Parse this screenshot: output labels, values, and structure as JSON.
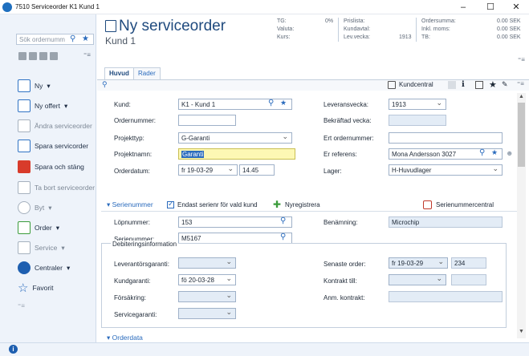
{
  "window": {
    "title": "7510 Serviceorder K1 Kund 1",
    "minimize": "–",
    "maximize": "☐",
    "close": "✕"
  },
  "sidebar": {
    "search_placeholder": "Sök ordernumm",
    "items": [
      {
        "label": "Ny",
        "icon": "new-document-icon"
      },
      {
        "label": "Ny offert",
        "icon": "offer-icon"
      },
      {
        "label": "Ändra serviceorder",
        "icon": "edit-icon"
      },
      {
        "label": "Spara servicorder",
        "icon": "save-icon"
      },
      {
        "label": "Spara och stäng",
        "icon": "save-close-icon"
      },
      {
        "label": "Ta bort serviceorder",
        "icon": "delete-icon"
      },
      {
        "label": "Byt",
        "icon": "swap-icon"
      },
      {
        "label": "Order",
        "icon": "order-icon"
      },
      {
        "label": "Service",
        "icon": "service-icon"
      },
      {
        "label": "Centraler",
        "icon": "central-icon"
      },
      {
        "label": "Favorit",
        "icon": "star-icon"
      }
    ]
  },
  "header": {
    "title": "Ny serviceorder",
    "subtitle": "Kund 1",
    "tg_label": "TG:",
    "tg_value": "0%",
    "valuta_label": "Valuta:",
    "kurs_label": "Kurs:",
    "prislista_label": "Prislista:",
    "kundavtal_label": "Kundavtal:",
    "levvecka_label": "Lev.vecka:",
    "levvecka_value": "1913",
    "ordersumma_label": "Ordersumma:",
    "ordersumma_value": "0.00 SEK",
    "inklmoms_label": "Inkl. moms:",
    "inklmoms_value": "0.00 SEK",
    "tb_label": "TB:",
    "tb_value": "0.00 SEK"
  },
  "tabs": [
    {
      "label": "Huvud",
      "active": true
    },
    {
      "label": "Rader",
      "active": false
    }
  ],
  "toolbar": {
    "kundcentral": "Kundcentral"
  },
  "form": {
    "kund_label": "Kund:",
    "kund_value": "K1 - Kund 1",
    "ordernummer_label": "Ordernummer:",
    "ordernummer_value": "",
    "projekttyp_label": "Projekttyp:",
    "projekttyp_value": "G-Garanti",
    "projektnamn_label": "Projektnamn:",
    "projektnamn_value": "Garanti",
    "orderdatum_label": "Orderdatum:",
    "orderdatum_value": "fr 19-03-29",
    "ordertid_value": "14.45",
    "leveransvecka_label": "Leveransvecka:",
    "leveransvecka_value": "1913",
    "bekraftad_label": "Bekräftad vecka:",
    "bekraftad_value": "",
    "ert_ordernummer_label": "Ert ordernummer:",
    "ert_ordernummer_value": "",
    "er_referens_label": "Er referens:",
    "er_referens_value": "Mona Andersson 3027",
    "lager_label": "Lager:",
    "lager_value": "H-Huvudlager"
  },
  "serial": {
    "section_title": "Serienummer",
    "only_for_customer": "Endast serienr för vald kund",
    "register": "Nyregistrera",
    "central": "Serienummercentral",
    "lopnummer_label": "Löpnummer:",
    "lopnummer_value": "153",
    "serienummer_label": "Serienummer:",
    "serienummer_value": "M5167",
    "benamning_label": "Benämning:",
    "benamning_value": "Microchip"
  },
  "debit": {
    "legend": "Debiteringsinformation",
    "leverantor_label": "Leverantörsgaranti:",
    "leverantor_value": "",
    "kundgaranti_label": "Kundgaranti:",
    "kundgaranti_value": "fö 20-03-28",
    "forsakring_label": "Försäkring:",
    "forsakring_value": "",
    "servicegaranti_label": "Servicegaranti:",
    "servicegaranti_value": "",
    "senaste_label": "Senaste order:",
    "senaste_value": "fr 19-03-29",
    "senaste_num": "234",
    "kontrakt_label": "Kontrakt till:",
    "kontrakt_value": "",
    "anm_label": "Anm. kontrakt:",
    "anm_value": ""
  },
  "orderdata": {
    "section_title": "Orderdata"
  }
}
